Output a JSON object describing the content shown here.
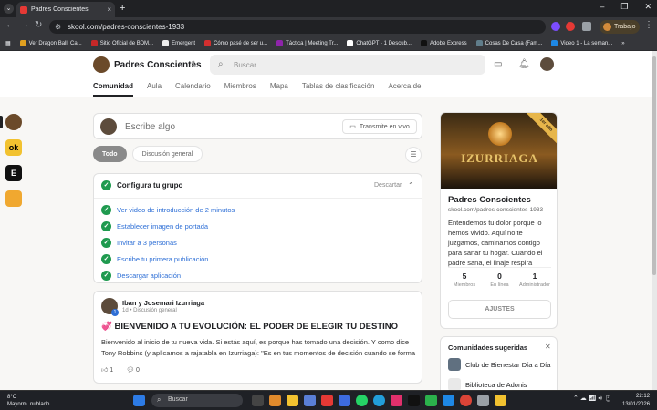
{
  "browser": {
    "tab_title": "Padres Conscientes",
    "tab_close": "×",
    "new_tab": "+",
    "url": "skool.com/padres-conscientes-1933",
    "profile_label": "Trabajo",
    "window_controls": [
      "–",
      "❐",
      "✕"
    ],
    "bookmarks": [
      "Ver Dragon Ball: Ca...",
      "Sitio Oficial de BDM...",
      "Emergent",
      "Cómo pasé de ser u...",
      "Táctica | Meeting Tr...",
      "ChatGPT - 1 Descub...",
      "Adobe Express",
      "Cosas De Casa (Fam...",
      "Video 1 - La seman..."
    ],
    "bookmark_overflow": "»"
  },
  "header": {
    "group_name": "Padres Conscientes",
    "search_placeholder": "Buscar",
    "nav_tabs": [
      "Comunidad",
      "Aula",
      "Calendario",
      "Miembros",
      "Mapa",
      "Tablas de clasificación",
      "Acerca de"
    ]
  },
  "siderail": {
    "items": [
      {
        "label": ""
      },
      {
        "label": "ok"
      },
      {
        "label": "E"
      },
      {
        "label": ""
      }
    ]
  },
  "composer": {
    "placeholder": "Escribe algo",
    "live_label": "Transmite en vivo"
  },
  "filters": [
    "Todo",
    "Discusión general"
  ],
  "setup": {
    "title": "Configura tu grupo",
    "dismiss": "Descartar",
    "steps": [
      "Ver video de introducción de 2 minutos",
      "Establecer imagen de portada",
      "Invitar a 3 personas",
      "Escribe tu primera publicación",
      "Descargar aplicación"
    ]
  },
  "post": {
    "author": "Iban y Josemari  Izurriaga",
    "badge": "1",
    "meta": "1d • Discusión general",
    "title": "💞 BIENVENIDO A TU EVOLUCIÓN: EL PODER DE ELEGIR TU DESTINO",
    "body": "Bienvenido al inicio de tu nueva vida. Si estás aquí, es porque has tomado una decisión. Y como dice Tony Robbins (y aplicamos a rajatabla en Izurriaga): \"Es en tus momentos de decisión cuando se forma",
    "likes": "1",
    "comments": "0"
  },
  "group_card": {
    "cover_title": "IZURRIAGA",
    "ribbon": "1er año",
    "name": "Padres Conscientes",
    "url": "skool.com/padres-conscientes-1933",
    "description": "Entendemos tu dolor porque lo hemos vivido. Aquí no te juzgamos, caminamos contigo para sanar tu hogar. Cuando el padre sana, el linaje respira",
    "stats": [
      {
        "value": "5",
        "label": "Miembros"
      },
      {
        "value": "0",
        "label": "En línea"
      },
      {
        "value": "1",
        "label": "Administrador"
      }
    ],
    "settings_button": "AJUSTES"
  },
  "suggested": {
    "title": "Comunidades sugeridas",
    "items": [
      "Club de Bienestar Día a Día",
      "Biblioteca de Adonis"
    ]
  },
  "taskbar": {
    "temperature": "8°C",
    "weather": "Mayorm. nublado",
    "search_label": "Buscar",
    "time": "22:12",
    "date": "13/01/2026"
  }
}
